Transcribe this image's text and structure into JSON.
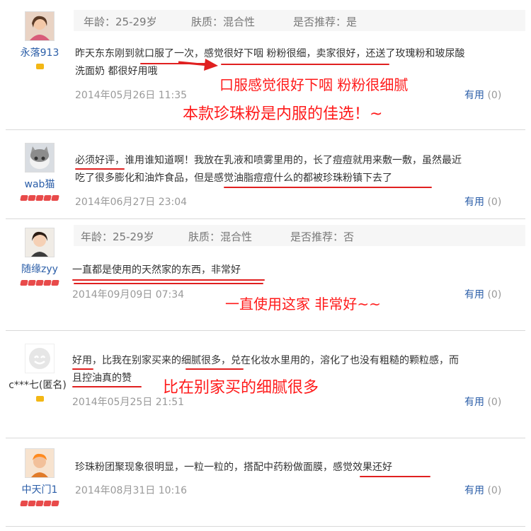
{
  "reviews": [
    {
      "user": "永落913",
      "meta": {
        "age": "年龄：25-29岁",
        "skin": "肤质：混合性",
        "recommend": "是否推荐：是"
      },
      "comment_line1": "昨天东东刚到就口服了一次，感觉很好下咽 粉粉很细，卖家很好，还送了玫瑰粉和玻尿酸",
      "comment_line2": "洗面奶 都很好用哦",
      "date": "2014年05月26日 11:35",
      "useful_label": "有用",
      "useful_count": "(0)",
      "note1": "口服感觉很好下咽 粉粉很细腻",
      "note2": "本款珍珠粉是内服的佳选！~"
    },
    {
      "user": "wab猫",
      "comment_line1": "必须好评，谁用谁知道啊！我放在乳液和喷雾里用的，长了痘痘就用来敷一敷，虽然最近",
      "comment_line2": "吃了很多膨化和油炸食品，但是感觉油脂痘痘什么的都被珍珠粉镇下去了",
      "date": "2014年06月27日 23:04",
      "useful_label": "有用",
      "useful_count": "(0)"
    },
    {
      "user": "随缘zyy",
      "meta": {
        "age": "年龄：25-29岁",
        "skin": "肤质：混合性",
        "recommend": "是否推荐：否"
      },
      "comment_line1": "一直都是使用的天然家的东西，非常好",
      "date": "2014年09月09日 07:34",
      "useful_label": "有用",
      "useful_count": "(0)",
      "note1": "一直使用这家 非常好~~"
    },
    {
      "user": "c***七(匿名)",
      "comment_line1": "好用，比我在别家买来的细腻很多，兑在化妆水里用的，溶化了也没有粗糙的颗粒感，而",
      "comment_line2": "且控油真的赞",
      "date": "2014年05月25日 21:51",
      "useful_label": "有用",
      "useful_count": "(0)",
      "note1": "比在别家买的细腻很多"
    },
    {
      "user": "中天门1",
      "comment_line1": "珍珠粉团聚现象很明显，一粒一粒的，搭配中药粉做面膜，感觉效果还好",
      "date": "2014年08月31日 10:16",
      "useful_label": "有用",
      "useful_count": "(0)"
    }
  ],
  "colors": {
    "username": "#2b5ea8",
    "annotation": "#ff1a1a",
    "meta_bg": "#f6f6f6"
  }
}
